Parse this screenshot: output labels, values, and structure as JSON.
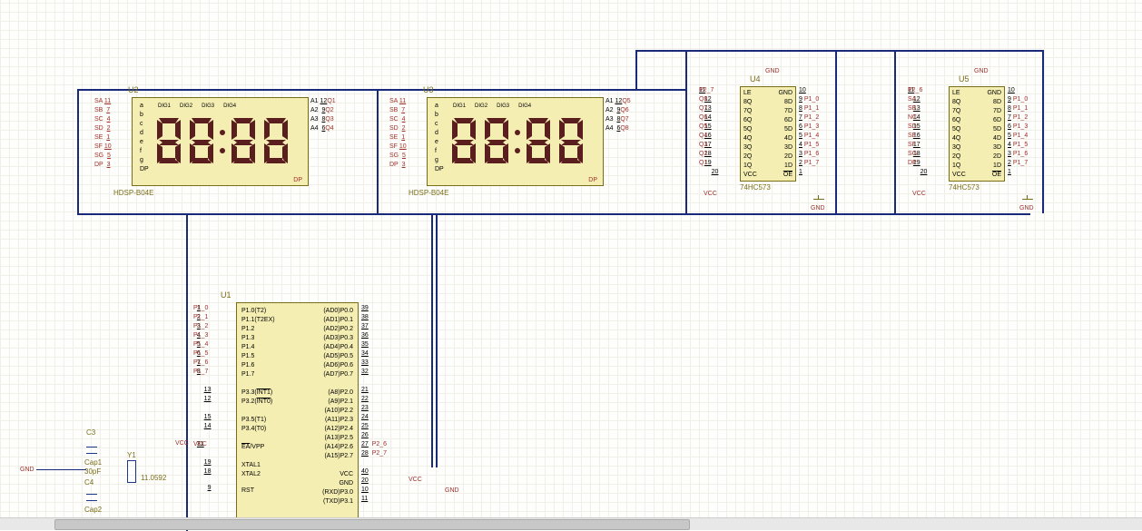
{
  "components": {
    "u1": {
      "ref": "U1",
      "left_pins": [
        {
          "num": "1",
          "name": "P1.0(T2)",
          "net": "P1_0"
        },
        {
          "num": "2",
          "name": "P1.1(T2EX)",
          "net": "P1_1"
        },
        {
          "num": "3",
          "name": "P1.2",
          "net": "P1_2"
        },
        {
          "num": "4",
          "name": "P1.3",
          "net": "P1_3"
        },
        {
          "num": "5",
          "name": "P1.4",
          "net": "P1_4"
        },
        {
          "num": "6",
          "name": "P1.5",
          "net": "P1_5"
        },
        {
          "num": "7",
          "name": "P1.6",
          "net": "P1_6"
        },
        {
          "num": "8",
          "name": "P1.7",
          "net": "P1_7"
        },
        {
          "num": "13",
          "name": "P3.3(INT1)"
        },
        {
          "num": "12",
          "name": "P3.2(INT0)"
        },
        {
          "num": "15",
          "name": "P3.5(T1)"
        },
        {
          "num": "14",
          "name": "P3.4(T0)"
        },
        {
          "num": "31",
          "name": "EA/VPP"
        },
        {
          "num": "19",
          "name": "XTAL1"
        },
        {
          "num": "18",
          "name": "XTAL2"
        },
        {
          "num": "9",
          "name": "RST"
        }
      ],
      "right_pins": [
        {
          "num": "39",
          "name": "(AD0)P0.0"
        },
        {
          "num": "38",
          "name": "(AD1)P0.1"
        },
        {
          "num": "37",
          "name": "(AD2)P0.2"
        },
        {
          "num": "36",
          "name": "(AD3)P0.3"
        },
        {
          "num": "35",
          "name": "(AD4)P0.4"
        },
        {
          "num": "34",
          "name": "(AD5)P0.5"
        },
        {
          "num": "33",
          "name": "(AD6)P0.6"
        },
        {
          "num": "32",
          "name": "(AD7)P0.7"
        },
        {
          "num": "21",
          "name": "(A8)P2.0"
        },
        {
          "num": "22",
          "name": "(A9)P2.1"
        },
        {
          "num": "23",
          "name": "(A10)P2.2"
        },
        {
          "num": "24",
          "name": "(A11)P2.3"
        },
        {
          "num": "25",
          "name": "(A12)P2.4"
        },
        {
          "num": "26",
          "name": "(A13)P2.5"
        },
        {
          "num": "27",
          "name": "(A14)P2.6",
          "net": "P2_6"
        },
        {
          "num": "28",
          "name": "(A15)P2.7",
          "net": "P2_7"
        },
        {
          "num": "40",
          "name": "VCC"
        },
        {
          "num": "20",
          "name": "GND"
        },
        {
          "num": "10",
          "name": "(RXD)P3.0"
        },
        {
          "num": "11",
          "name": "(TXD)P3.1"
        }
      ]
    },
    "u2": {
      "ref": "U2",
      "part": "HDSP-B04E",
      "left_pins": [
        {
          "name": "SA",
          "num": "11"
        },
        {
          "name": "SB",
          "num": "7"
        },
        {
          "name": "SC",
          "num": "4"
        },
        {
          "name": "SD",
          "num": "2"
        },
        {
          "name": "SE",
          "num": "1"
        },
        {
          "name": "SF",
          "num": "10"
        },
        {
          "name": "SG",
          "num": "5"
        },
        {
          "name": "DP",
          "num": "3"
        }
      ],
      "right_pins": [
        {
          "name": "A1",
          "num": "12",
          "net": "Q1"
        },
        {
          "name": "A2",
          "num": "9",
          "net": "Q2"
        },
        {
          "name": "A3",
          "num": "8",
          "net": "Q3"
        },
        {
          "name": "A4",
          "num": "6",
          "net": "Q4"
        }
      ],
      "segs": [
        "a",
        "b",
        "c",
        "d",
        "e",
        "f",
        "g",
        "DP"
      ],
      "digits": [
        "DIG1",
        "DIG2",
        "DIG3",
        "DIG4"
      ]
    },
    "u3": {
      "ref": "U3",
      "part": "HDSP-B04E",
      "left_pins": [
        {
          "name": "SA",
          "num": "11"
        },
        {
          "name": "SB",
          "num": "7"
        },
        {
          "name": "SC",
          "num": "4"
        },
        {
          "name": "SD",
          "num": "2"
        },
        {
          "name": "SE",
          "num": "1"
        },
        {
          "name": "SF",
          "num": "10"
        },
        {
          "name": "SG",
          "num": "5"
        },
        {
          "name": "DP",
          "num": "3"
        }
      ],
      "right_pins": [
        {
          "name": "A1",
          "num": "12",
          "net": "Q5"
        },
        {
          "name": "A2",
          "num": "9",
          "net": "Q6"
        },
        {
          "name": "A3",
          "num": "8",
          "net": "Q7"
        },
        {
          "name": "A4",
          "num": "6",
          "net": "Q8"
        }
      ],
      "segs": [
        "a",
        "b",
        "c",
        "d",
        "e",
        "f",
        "g",
        "DP"
      ],
      "digits": [
        "DIG1",
        "DIG2",
        "DIG3",
        "DIG4"
      ]
    },
    "u4": {
      "ref": "U4",
      "part": "74HC573",
      "left_pins": [
        {
          "num": "11",
          "name": "LE",
          "net": "P2_7"
        },
        {
          "num": "12",
          "name": "8Q",
          "net": "Q8"
        },
        {
          "num": "13",
          "name": "7Q",
          "net": "Q7"
        },
        {
          "num": "14",
          "name": "6Q",
          "net": "Q6"
        },
        {
          "num": "15",
          "name": "5Q",
          "net": "Q5"
        },
        {
          "num": "16",
          "name": "4Q",
          "net": "Q4"
        },
        {
          "num": "17",
          "name": "3Q",
          "net": "Q3"
        },
        {
          "num": "18",
          "name": "2Q",
          "net": "Q2"
        },
        {
          "num": "19",
          "name": "1Q",
          "net": "Q1"
        },
        {
          "num": "20",
          "name": "VCC"
        }
      ],
      "right_pins": [
        {
          "num": "10",
          "name": "GND"
        },
        {
          "num": "9",
          "name": "8D",
          "net": "P1_0"
        },
        {
          "num": "8",
          "name": "7D",
          "net": "P1_1"
        },
        {
          "num": "7",
          "name": "6D",
          "net": "P1_2"
        },
        {
          "num": "6",
          "name": "5D",
          "net": "P1_3"
        },
        {
          "num": "5",
          "name": "4D",
          "net": "P1_4"
        },
        {
          "num": "4",
          "name": "3D",
          "net": "P1_5"
        },
        {
          "num": "3",
          "name": "2D",
          "net": "P1_6"
        },
        {
          "num": "2",
          "name": "1D",
          "net": "P1_7"
        },
        {
          "num": "1",
          "name": "OE"
        }
      ]
    },
    "u5": {
      "ref": "U5",
      "part": "74HC573",
      "left_pins": [
        {
          "num": "11",
          "name": "LE",
          "net": "P2_6"
        },
        {
          "num": "12",
          "name": "8Q",
          "net": "SA"
        },
        {
          "num": "13",
          "name": "7Q",
          "net": "SB"
        },
        {
          "num": "14",
          "name": "6Q",
          "net": "NC"
        },
        {
          "num": "15",
          "name": "5Q",
          "net": "SD"
        },
        {
          "num": "16",
          "name": "4Q",
          "net": "SE"
        },
        {
          "num": "17",
          "name": "3Q",
          "net": "SF"
        },
        {
          "num": "18",
          "name": "2Q",
          "net": "SG"
        },
        {
          "num": "19",
          "name": "1Q",
          "net": "DP"
        },
        {
          "num": "20",
          "name": "VCC"
        }
      ],
      "right_pins": [
        {
          "num": "10",
          "name": "GND"
        },
        {
          "num": "9",
          "name": "8D",
          "net": "P1_0"
        },
        {
          "num": "8",
          "name": "7D",
          "net": "P1_1"
        },
        {
          "num": "7",
          "name": "6D",
          "net": "P1_2"
        },
        {
          "num": "6",
          "name": "5D",
          "net": "P1_3"
        },
        {
          "num": "5",
          "name": "4D",
          "net": "P1_4"
        },
        {
          "num": "4",
          "name": "3D",
          "net": "P1_5"
        },
        {
          "num": "3",
          "name": "2D",
          "net": "P1_6"
        },
        {
          "num": "2",
          "name": "1D",
          "net": "P1_7"
        },
        {
          "num": "1",
          "name": "OE"
        }
      ]
    },
    "crystal": {
      "ref": "Y1",
      "value": "11.0592"
    },
    "caps": {
      "c3": {
        "ref": "C3",
        "part": "Cap1",
        "value": "30pF"
      },
      "c4": {
        "ref": "C4",
        "part": "Cap2"
      }
    }
  },
  "power": {
    "vcc": "VCC",
    "gnd": "GND"
  },
  "display": "88:88"
}
